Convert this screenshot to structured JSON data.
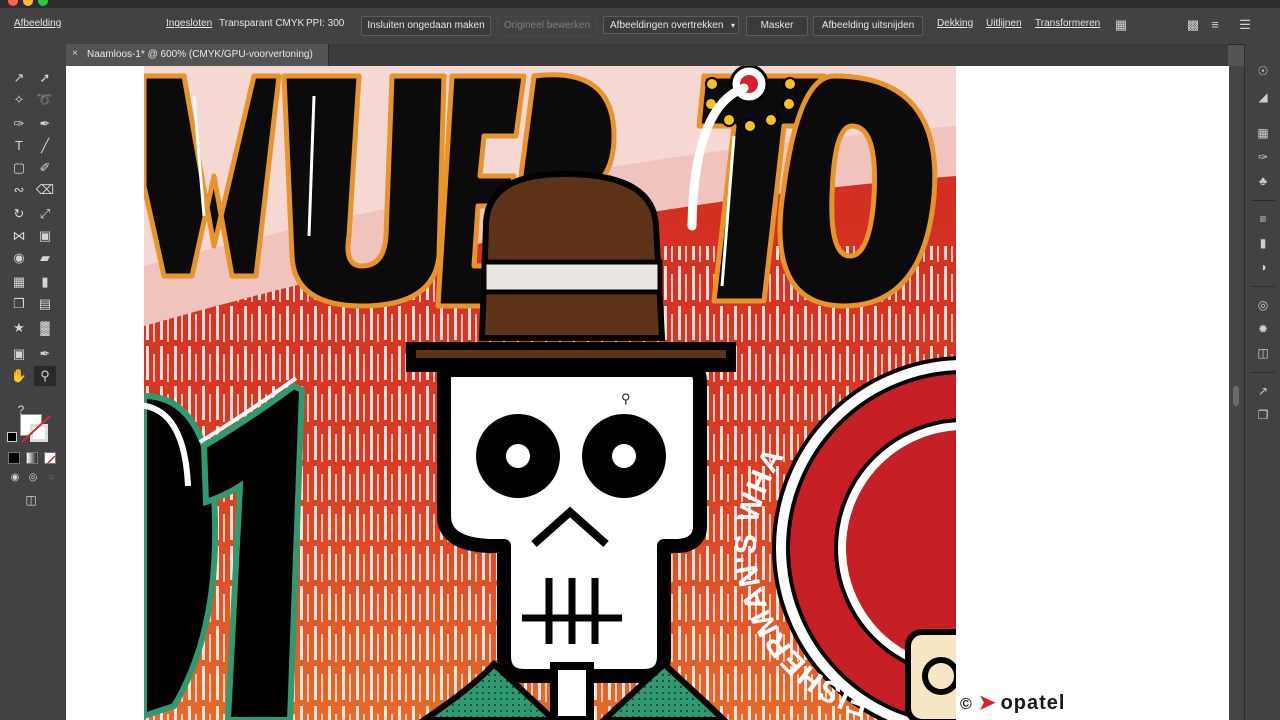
{
  "control_bar": {
    "selection_type": "Afbeelding",
    "embedded_link": "Ingesloten",
    "color_mode": "Transparant CMYK",
    "ppi_label": "PPI: 300",
    "unembed_button": "Insluiten ongedaan maken",
    "edit_original_button": "Origineel bewerken",
    "trace_button": "Afbeeldingen overtrekken",
    "mask_button": "Masker",
    "crop_button": "Afbeelding uitsnijden",
    "opacity_link": "Dekking",
    "align_link": "Uitlijnen",
    "transform_link": "Transformeren"
  },
  "document_tab": {
    "title": "Naamloos-1* @ 600% (CMYK/GPU-voorvertoning)",
    "close_glyph": "×"
  },
  "artwork_text": {
    "headline_fragment": "MUERTO",
    "badge_text": "FISHERMAN'S WHA"
  },
  "toolbar": {
    "unknown_tool_glyph": "?"
  },
  "watermark": {
    "copyright_symbol": "©",
    "brand": "opatel"
  },
  "colors": {
    "app_bg": "#535353",
    "panel_bg": "#424242",
    "poster_red": "#d8261c",
    "poster_orange": "#e2582a",
    "hat_brown": "#5e3317",
    "outline_orange": "#e7942a",
    "badge_red": "#c62026",
    "suit_green": "#2f9a70"
  }
}
